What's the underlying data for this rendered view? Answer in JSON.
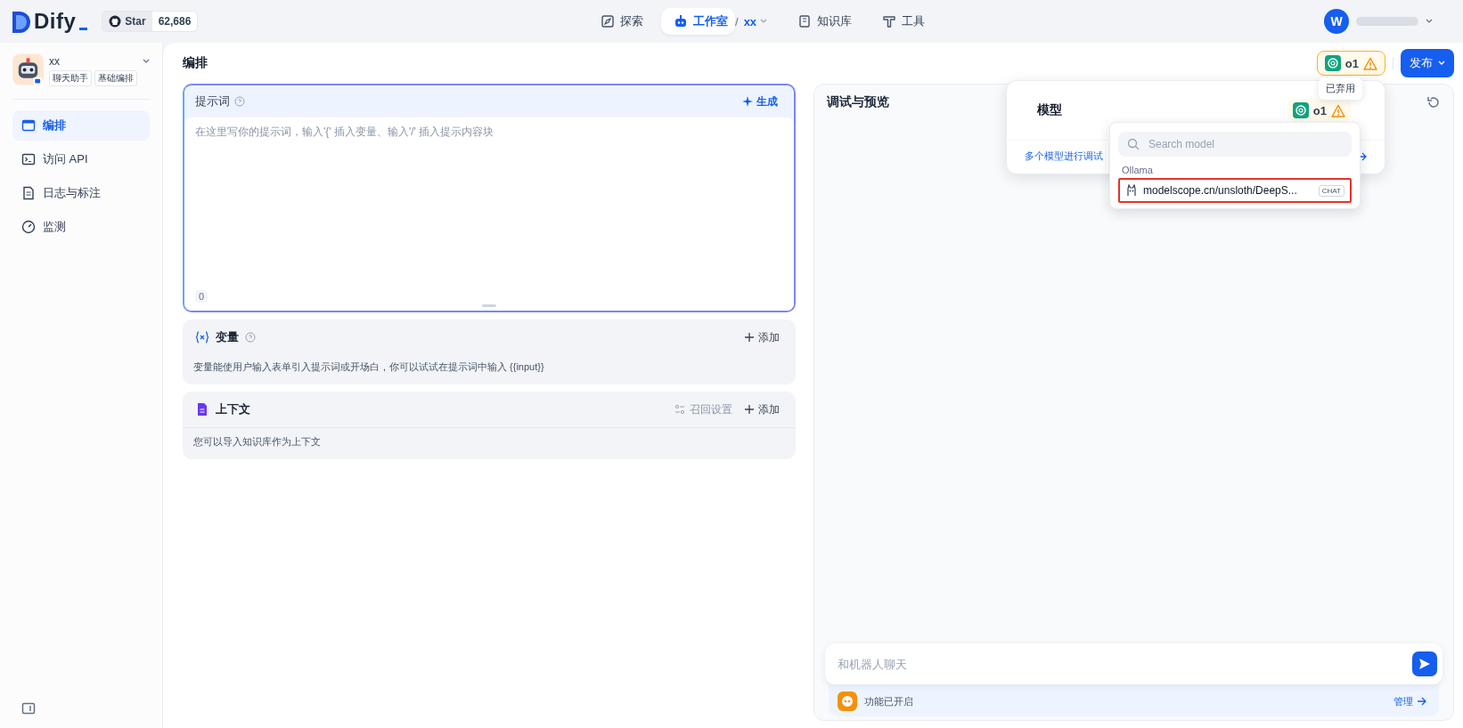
{
  "top_nav": {
    "logo": "Dify",
    "star": {
      "label": "Star",
      "count": "62,686"
    },
    "nav_items": [
      {
        "label": "探索",
        "selected": false
      },
      {
        "label": "工作室",
        "selected": true,
        "breadcrumb_separator": "/",
        "breadcrumb": "xx"
      },
      {
        "label": "知识库",
        "selected": false
      },
      {
        "label": "工具",
        "selected": false
      }
    ],
    "user": {
      "initial": "W"
    }
  },
  "sidebar": {
    "app": {
      "name": "xx",
      "tags": [
        "聊天助手",
        "基础编排"
      ]
    },
    "items": [
      {
        "label": "编排",
        "selected": true
      },
      {
        "label": "访问 API",
        "selected": false
      },
      {
        "label": "日志与标注",
        "selected": false
      },
      {
        "label": "监测",
        "selected": false
      }
    ]
  },
  "main": {
    "title": "编排",
    "model_button": {
      "label": "o1",
      "tooltip": "已弃用"
    },
    "publish_button": "发布",
    "prompt": {
      "title": "提示词",
      "generate": "生成",
      "placeholder": "在这里写你的提示词，输入'{' 插入变量、输入'/' 插入提示内容块",
      "count": "0"
    },
    "variables": {
      "title": "变量",
      "add": "添加",
      "description": "变量能使用户输入表单引入提示词或开场白，你可以试试在提示词中输入 {{input}}"
    },
    "context": {
      "title": "上下文",
      "retrieval_settings": {
        "label": "召回设置",
        "disabled": true
      },
      "add": "添加",
      "description": "您可以导入知识库作为上下文"
    }
  },
  "debug": {
    "title": "调试与预览",
    "chat_placeholder": "和机器人聊天",
    "features": {
      "label": "功能已开启",
      "manage": "管理"
    }
  },
  "model_popover": {
    "title": "模型",
    "model": "o1",
    "multi_model": "多个模型进行调试",
    "search_placeholder": "Search model",
    "groups": [
      {
        "provider": "Ollama",
        "models": [
          {
            "name": "modelscope.cn/unsloth/DeepS...",
            "badge": "CHAT",
            "highlighted": true
          }
        ]
      }
    ]
  }
}
